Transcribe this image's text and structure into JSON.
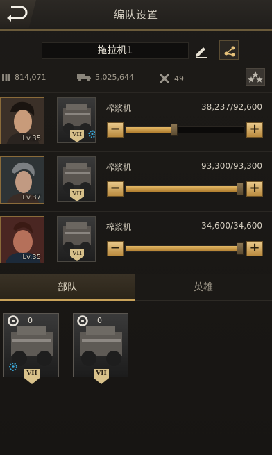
{
  "header": {
    "title": "编队设置"
  },
  "formation": {
    "name": "拖拉机1"
  },
  "stats": {
    "ammo": "814,071",
    "supplies": "5,025,644",
    "tools": "49"
  },
  "units": [
    {
      "hero_level": "Lv.35",
      "vehicle_rank": "VII",
      "name": "榨浆机",
      "count": "38,237/92,600",
      "fill": 0.41,
      "has_gear": true
    },
    {
      "hero_level": "Lv.37",
      "vehicle_rank": "VII",
      "name": "榨浆机",
      "count": "93,300/93,300",
      "fill": 1.0,
      "has_gear": false
    },
    {
      "hero_level": "Lv.35",
      "vehicle_rank": "VII",
      "name": "榨浆机",
      "count": "34,600/34,600",
      "fill": 1.0,
      "has_gear": false
    }
  ],
  "slider": {
    "minus": "−",
    "plus": "+"
  },
  "tabs": {
    "troops": "部队",
    "heroes": "英雄"
  },
  "troop_cards": [
    {
      "count": "0",
      "rank": "VII",
      "has_gear": true
    },
    {
      "count": "0",
      "rank": "VII",
      "has_gear": false
    }
  ],
  "colors": {
    "accent": "#c9a35a",
    "slider_fill": "#e3b865",
    "background": "#1a1815"
  }
}
